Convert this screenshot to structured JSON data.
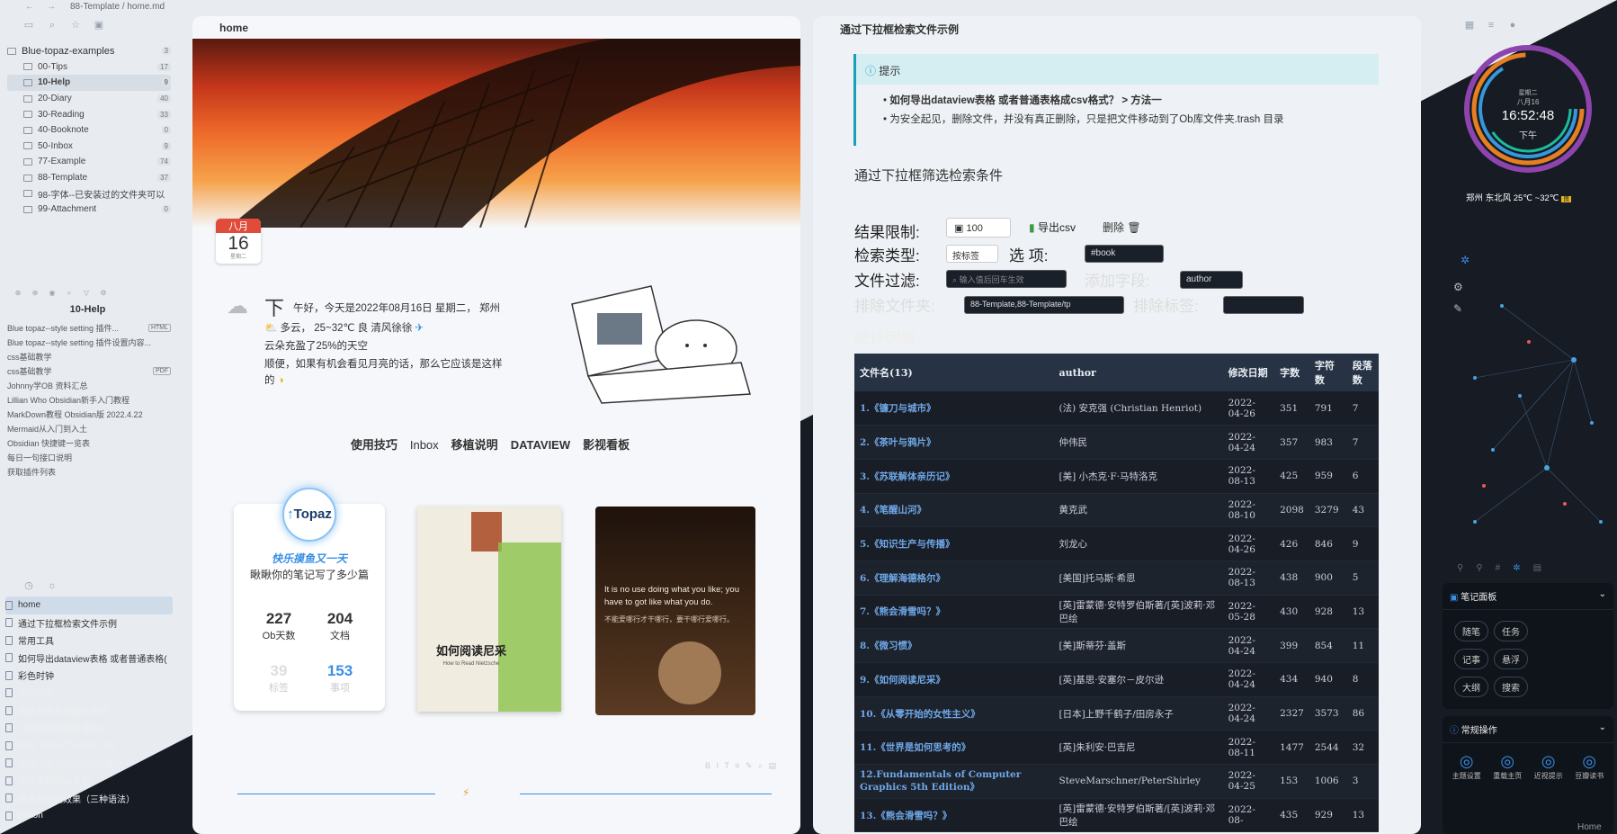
{
  "window": {
    "breadcrumb": "88-Template / home.md"
  },
  "sidebar": {
    "vault_name": "Blue-topaz-examples",
    "vault_count": "3",
    "folders": [
      {
        "label": "00-Tips",
        "count": "17"
      },
      {
        "label": "10-Help",
        "count": "9"
      },
      {
        "label": "20-Diary",
        "count": "40"
      },
      {
        "label": "30-Reading",
        "count": "33"
      },
      {
        "label": "40-Booknote",
        "count": "0"
      },
      {
        "label": "50-Inbox",
        "count": "9"
      },
      {
        "label": "77-Example",
        "count": "74"
      },
      {
        "label": "88-Template",
        "count": "37"
      },
      {
        "label": "98-字体--已安装过的文件夹可以",
        "count": ""
      },
      {
        "label": "99-Attachment",
        "count": "0"
      }
    ],
    "recent_title": "10-Help",
    "recent": [
      {
        "label": "Blue topaz--style setting 插件...",
        "tag": "HTML"
      },
      {
        "label": "Blue topaz--style setting 插件设置内容...",
        "tag": ""
      },
      {
        "label": "css基础教学",
        "tag": ""
      },
      {
        "label": "css基础教学",
        "tag": "PDF"
      },
      {
        "label": "Johnny学OB 资料汇总",
        "tag": ""
      },
      {
        "label": "Lillian Who Obsidian新手入门教程",
        "tag": ""
      },
      {
        "label": "MarkDown教程 Obsidian版 2022.4.22",
        "tag": ""
      },
      {
        "label": "Mermaid从入门到入土",
        "tag": ""
      },
      {
        "label": "Obsidian 快捷键一览表",
        "tag": ""
      },
      {
        "label": "每日一句接口说明",
        "tag": ""
      },
      {
        "label": "获取插件列表",
        "tag": ""
      }
    ],
    "files": [
      "home",
      "通过下拉框检索文件示例",
      "常用工具",
      "如何导出dataview表格 或者普通表格(",
      "彩色时钟",
      "README",
      "各类列表和彩虹大纲线",
      "《世界是如何思考的》",
      "Blue Topaz Themes Tips",
      "ob提示框(callout)样式展示",
      "可以编辑的dv表格",
      "涂黑和挖空效果（三种语法）",
      "button"
    ]
  },
  "left_pane": {
    "title": "home",
    "date_month": "八月",
    "date_day": "16",
    "date_week": "星期二",
    "greet_big": "下",
    "greet_line1": "午好，今天是2022年08月16日 星期二， 郑州",
    "greet_line2": "多云，  25~32℃ 良 清风徐徐",
    "greet_line3": "云朵充盈了25%的天空",
    "greet_line4": "顺便，如果有机会看见月亮的话，那么它应该是这样",
    "greet_line5": "的",
    "nav": [
      "使用技巧",
      "Inbox",
      "移植说明",
      "DATAVIEW",
      "影视看板"
    ],
    "card_logo": "Topaz",
    "card_slogan": "快乐摸鱼又一天",
    "card_sub": "瞅瞅你的笔记写了多少篇",
    "stats": [
      {
        "num": "227",
        "label": "Ob天数"
      },
      {
        "num": "204",
        "label": "文档"
      },
      {
        "num": "39",
        "label": "标签"
      },
      {
        "num": "153",
        "label": "事项"
      }
    ],
    "book_title": "如何阅读尼采",
    "book_sub": "How to Read Nietzsche",
    "quote_en": "It is no use doing what you like; you have to got like what you do.",
    "quote_cn": "不能爱哪行才干哪行，要干哪行爱哪行。"
  },
  "right_pane": {
    "title": "通过下拉框检索文件示例",
    "callout_title": "提示",
    "callout_1": "如何导出dataview表格 或者普通表格成csv格式？ > 方法一",
    "callout_2": "为安全起见，删除文件，并没有真正删除，只是把文件移动到了Ob库文件夹.trash 目录",
    "h_filter": "通过下拉框筛选检索条件",
    "lbl_limit": "结果限制:",
    "val_limit": "100",
    "btn_csv": "导出csv",
    "btn_delete": "删除",
    "lbl_type": "检索类型:",
    "val_type": "按标签",
    "lbl_option": "选  项:",
    "val_option": "#book",
    "lbl_filefilter": "文件过滤:",
    "ph_filefilter": "输入值后回车生效",
    "lbl_addfield": "添加字段:",
    "val_addfield": "author",
    "lbl_exfolder": "排除文件夹:",
    "val_exfolder": "88-Template,88-Template/tp",
    "lbl_extag": "排除标签:",
    "h_list": "统计列表",
    "columns": [
      "文件名(13)",
      "author",
      "修改日期",
      "字数",
      "字符数",
      "段落数"
    ],
    "rows": [
      [
        "1.《镰刀与城市》",
        "(法) 安克强 (Christian Henriot)",
        "2022-04-26",
        "351",
        "791",
        "7"
      ],
      [
        "2.《茶叶与鸦片》",
        "仲伟民",
        "2022-04-24",
        "357",
        "983",
        "7"
      ],
      [
        "3.《苏联解体亲历记》",
        "[美] 小杰克·F·马特洛克",
        "2022-08-13",
        "425",
        "959",
        "6"
      ],
      [
        "4.《笔醒山河》",
        "黄克武",
        "2022-08-10",
        "2098",
        "3279",
        "43"
      ],
      [
        "5.《知识生产与传播》",
        "刘龙心",
        "2022-04-26",
        "426",
        "846",
        "9"
      ],
      [
        "6.《理解海德格尔》",
        "[美国]托马斯·希恩",
        "2022-08-13",
        "438",
        "900",
        "5"
      ],
      [
        "7.《熊会滑雪吗？》",
        "[英]雷蒙德·安特罗伯斯著/[英]波莉·邓巴绘",
        "2022-05-28",
        "430",
        "928",
        "13"
      ],
      [
        "8.《微习惯》",
        "[美]斯蒂芬·盖斯",
        "2022-04-24",
        "399",
        "854",
        "11"
      ],
      [
        "9.《如何阅读尼采》",
        "[英]基思·安塞尔－皮尔逊",
        "2022-04-24",
        "434",
        "940",
        "8"
      ],
      [
        "10.《从零开始的女性主义》",
        "[日本]上野千鹤子/田房永子",
        "2022-04-24",
        "2327",
        "3573",
        "86"
      ],
      [
        "11.《世界是如何思考的》",
        "[英]朱利安·巴吉尼",
        "2022-08-11",
        "1477",
        "2544",
        "32"
      ],
      [
        "12.Fundamentals of Computer Graphics 5th Edition》",
        "SteveMarschner/PeterShirley",
        "2022-04-25",
        "153",
        "1006",
        "3"
      ],
      [
        "13.《熊会滑雪吗？》",
        "[英]雷蒙德·安特罗伯斯著/[英]波莉·邓巴绘",
        "2022-08-",
        "435",
        "929",
        "13"
      ]
    ]
  },
  "right_side": {
    "clock_weekday": "星期二",
    "clock_date": "八月16",
    "clock_time": "16:52:48",
    "clock_ampm": "下午",
    "weather": "郑州 东北风 25℃ ~32℃",
    "panel_notes": "笔记面板",
    "note_buttons": [
      "随笔",
      "任务",
      "记事",
      "悬浮",
      "大纲",
      "搜索"
    ],
    "panel_ops": "常规操作",
    "op_buttons": [
      "主题设置",
      "重载主页",
      "近视提示",
      "豆瓣读书"
    ],
    "home_label": "Home"
  }
}
